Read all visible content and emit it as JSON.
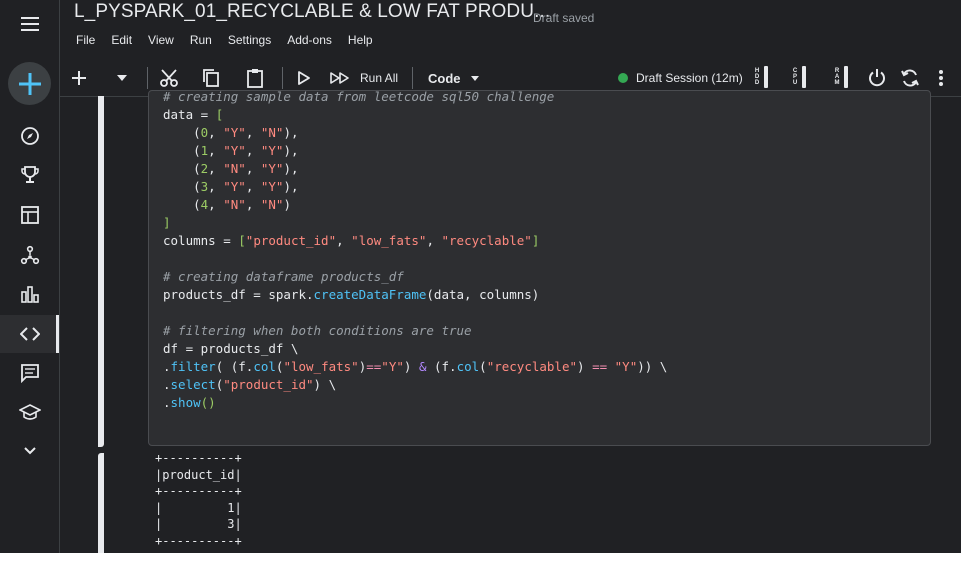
{
  "notebook": {
    "title": "L_PYSPARK_01_RECYCLABLE & LOW FAT PRODU...",
    "status": "Draft saved"
  },
  "menu": [
    "File",
    "Edit",
    "View",
    "Run",
    "Settings",
    "Add-ons",
    "Help"
  ],
  "toolbar": {
    "run_all_label": "Run All",
    "cell_type": "Code",
    "session_label": "Draft Session (12m)",
    "session_color": "#34a853",
    "meters": [
      "HDD",
      "CPU",
      "RAM"
    ]
  },
  "code": {
    "lines": [
      "# creating sample data from leetcode sql50 challenge",
      "data = [",
      "    (0, \"Y\", \"N\"),",
      "    (1, \"Y\", \"Y\"),",
      "    (2, \"N\", \"Y\"),",
      "    (3, \"Y\", \"Y\"),",
      "    (4, \"N\", \"N\")",
      "]",
      "columns = [\"product_id\", \"low_fats\", \"recyclable\"]",
      "",
      "# creating dataframe products_df",
      "products_df = spark.createDataFrame(data, columns)",
      "",
      "# filtering when both conditions are true",
      "df = products_df \\",
      ".filter( (f.col(\"low_fats\")==\"Y\") & (f.col(\"recyclable\") == \"Y\")) \\",
      ".select(\"product_id\") \\",
      ".show()"
    ]
  },
  "output": {
    "lines": [
      "+----------+",
      "|product_id|",
      "+----------+",
      "|         1|",
      "|         3|",
      "+----------+"
    ]
  }
}
